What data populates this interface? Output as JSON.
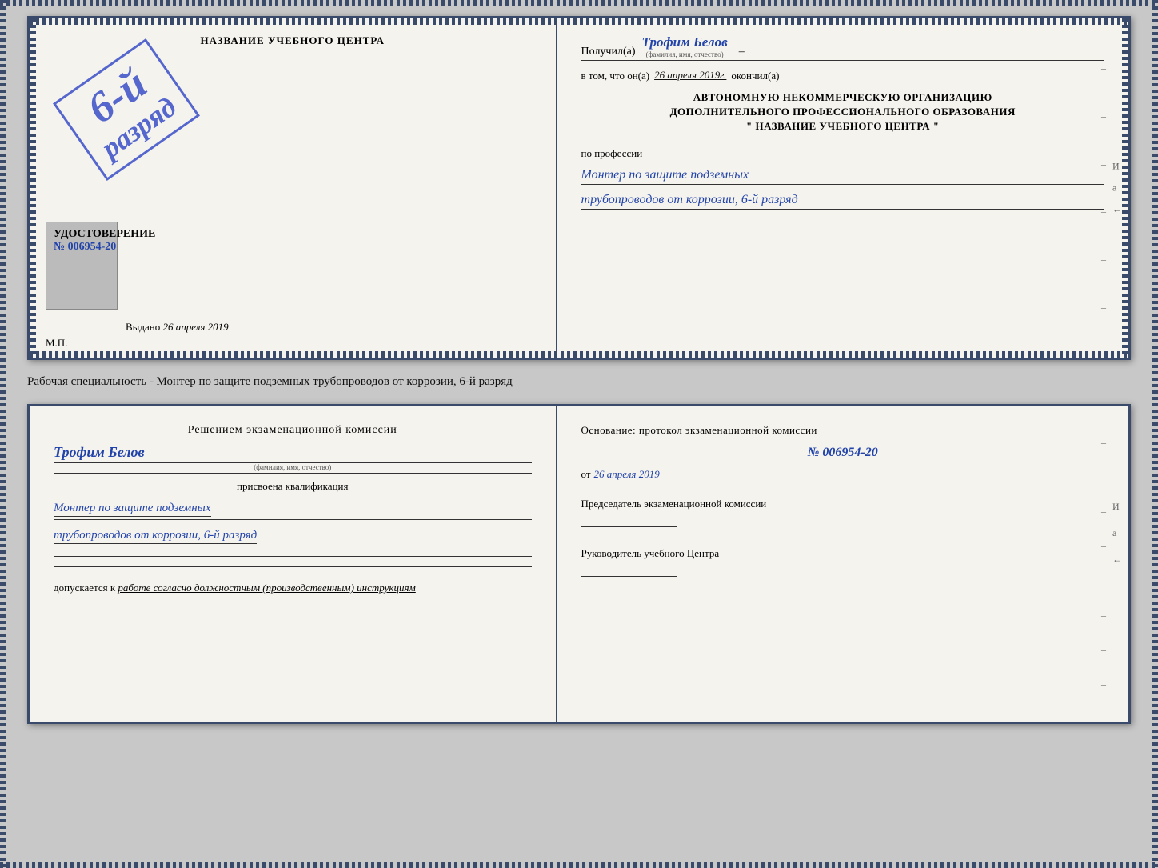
{
  "top_cert": {
    "left": {
      "title": "НАЗВАНИЕ УЧЕБНОГО ЦЕНТРА",
      "stamp_6": "6-й",
      "stamp_razryad": "разряд",
      "udostoverenie_label": "УДОСТОВЕРЕНИЕ",
      "udostoverenie_num": "№ 006954-20",
      "vydano_label": "Выдано",
      "vydano_date": "26 апреля 2019",
      "mp_label": "М.П."
    },
    "right": {
      "poluchil_label": "Получил(а)",
      "poluchil_name": "Трофим Белов",
      "poluchil_sub": "(фамилия, имя, отчество)",
      "vtom_label": "в том, что он(а)",
      "vtom_date": "26 апреля 2019г.",
      "okonchil_label": "окончил(а)",
      "org_line1": "АВТОНОМНУЮ НЕКОММЕРЧЕСКУЮ ОРГАНИЗАЦИЮ",
      "org_line2": "ДОПОЛНИТЕЛЬНОГО ПРОФЕССИОНАЛЬНОГО ОБРАЗОВАНИЯ",
      "org_line3": "\"  НАЗВАНИЕ УЧЕБНОГО ЦЕНТРА  \"",
      "po_professii_label": "по профессии",
      "profession_line1": "Монтер по защите подземных",
      "profession_line2": "трубопроводов от коррозии, 6-й разряд",
      "corner_И": "И",
      "corner_а": "а",
      "corner_arrow": "←",
      "dashes": [
        "–",
        "–",
        "–",
        "–",
        "–",
        "–"
      ]
    }
  },
  "middle": {
    "text": "Рабочая специальность - Монтер по защите подземных трубопроводов от коррозии, 6-й разряд"
  },
  "bottom_cert": {
    "left": {
      "decision_title": "Решением экзаменационной комиссии",
      "name": "Трофим Белов",
      "name_sub": "(фамилия, имя, отчество)",
      "prisvoena_label": "присвоена квалификация",
      "profession_line1": "Монтер по защите подземных",
      "profession_line2": "трубопроводов от коррозии, 6-й разряд",
      "dopusk_label": "допускается к",
      "dopusk_value": "работе согласно должностным (производственным) инструкциям"
    },
    "right": {
      "osnov_label": "Основание: протокол экзаменационной комиссии",
      "protocol_num": "№ 006954-20",
      "ot_prefix": "от",
      "ot_date": "26 апреля 2019",
      "predsedatel_label": "Председатель экзаменационной комиссии",
      "rukovoditel_label": "Руководитель учебного Центра",
      "corner_И": "И",
      "corner_а": "а",
      "corner_arrow": "←",
      "dashes": [
        "–",
        "–",
        "–",
        "–",
        "–",
        "–",
        "–",
        "–"
      ]
    }
  }
}
